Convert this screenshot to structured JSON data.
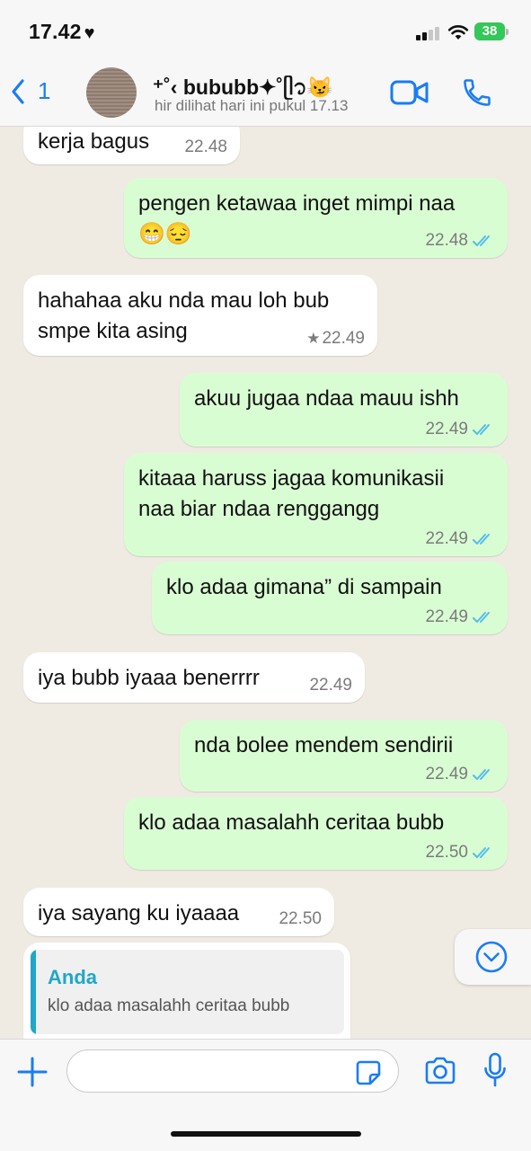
{
  "status_bar": {
    "time": "17.42",
    "heart": "♥",
    "battery": "38"
  },
  "header": {
    "back_count": "1",
    "contact_name": "⁺˚‹ bububb✦˚ᥫ᭡😼",
    "contact_status": "hir dilihat hari ini pukul 17.13"
  },
  "messages": [
    {
      "dir": "in",
      "lines": [
        "kerja bagus"
      ],
      "time": "22.48"
    },
    {
      "dir": "out",
      "lines": [
        "pengen ketawaa inget mimpi naa",
        "😁😔"
      ],
      "time": "22.48",
      "read": true
    },
    {
      "dir": "in",
      "lines": [
        "hahahaa aku nda mau loh bub",
        "smpe kita asing"
      ],
      "time": "22.49",
      "starred": true
    },
    {
      "dir": "out",
      "lines": [
        "akuu jugaa ndaa mauu ishh"
      ],
      "time": "22.49",
      "read": true
    },
    {
      "dir": "out",
      "lines": [
        "kitaaa haruss jagaa komunikasii",
        "naa biar ndaa renggangg"
      ],
      "time": "22.49",
      "read": true
    },
    {
      "dir": "out",
      "lines": [
        "klo adaa gimana” di sampain"
      ],
      "time": "22.49",
      "read": true
    },
    {
      "dir": "in",
      "lines": [
        "iya bubb iyaaa benerrrr"
      ],
      "time": "22.49"
    },
    {
      "dir": "out",
      "lines": [
        "nda bolee mendem sendirii"
      ],
      "time": "22.49",
      "read": true
    },
    {
      "dir": "out",
      "lines": [
        "klo adaa masalahh ceritaa bubb"
      ],
      "time": "22.50",
      "read": true
    },
    {
      "dir": "in",
      "lines": [
        "iya sayang ku iyaaaa"
      ],
      "time": "22.50"
    }
  ],
  "reply": {
    "author": "Anda",
    "text": "klo adaa masalahh ceritaa bubb"
  },
  "input": {
    "placeholder": ""
  },
  "colors": {
    "accent": "#1a7cf5",
    "outgoing_bubble": "#d9fdd3",
    "incoming_bubble": "#ffffff",
    "read_ticks": "#53bdeb",
    "chat_background": "#efeae2"
  }
}
